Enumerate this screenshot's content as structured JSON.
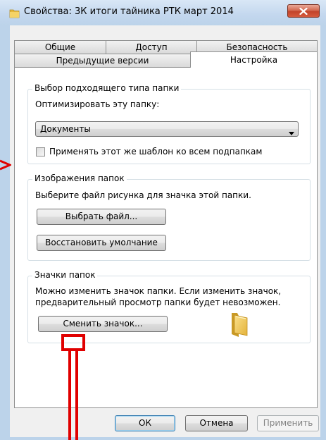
{
  "window": {
    "title": "Свойства: 3К итоги тайника РТК март 2014"
  },
  "tabs": {
    "row1": [
      "Общие",
      "Доступ",
      "Безопасность"
    ],
    "row2": [
      "Предыдущие версии",
      "Настройка"
    ],
    "active": "Настройка"
  },
  "folder_type": {
    "group_title": "Выбор подходящего типа папки",
    "optimize_label": "Оптимизировать эту папку:",
    "selected_value": "Документы",
    "apply_subfolders_label": "Применять этот же шаблон ко всем подпапкам",
    "apply_subfolders_checked": false
  },
  "folder_pictures": {
    "group_title": "Изображения папок",
    "description": "Выберите файл рисунка для значка этой папки.",
    "choose_file_label": "Выбрать файл...",
    "restore_default_label": "Восстановить умолчание"
  },
  "folder_icons": {
    "group_title": "Значки папок",
    "description_line1": "Можно изменить значок папки. Если изменить значок,",
    "description_line2": "предварительный просмотр папки будет невозможен.",
    "change_icon_label": "Сменить значок..."
  },
  "footer": {
    "ok_label": "ОК",
    "cancel_label": "Отмена",
    "apply_label": "Применить"
  },
  "icons": {
    "title": "folder-icon",
    "close": "close-icon",
    "dropdown": "chevron-down-icon",
    "preview": "folder-icon"
  },
  "colors": {
    "annotation": "#e00000",
    "window_frame": "#bcd3ea",
    "close_button": "#c7432b"
  }
}
